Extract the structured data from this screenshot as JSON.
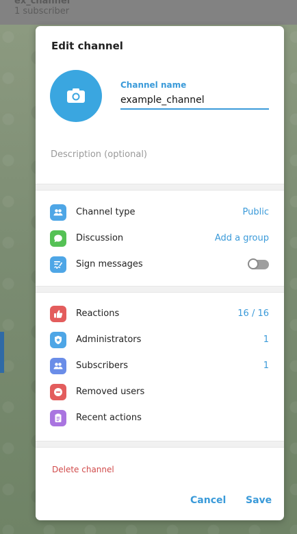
{
  "background": {
    "channel_title": "ex_channel",
    "channel_subtitle": "1 subscriber"
  },
  "modal": {
    "title": "Edit channel",
    "name_label": "Channel name",
    "name_value": "example_channel",
    "description_placeholder": "Description (optional)",
    "settings": [
      {
        "label": "Channel type",
        "value": "Public",
        "icon": "people-icon",
        "color": "#4ea6e6"
      },
      {
        "label": "Discussion",
        "value": "Add a group",
        "icon": "chat-bubble-icon",
        "color": "#55c155"
      },
      {
        "label": "Sign messages",
        "value": "",
        "icon": "signature-icon",
        "color": "#4ea6e6"
      }
    ],
    "sign_messages_enabled": false,
    "manage": [
      {
        "label": "Reactions",
        "value": "16 / 16",
        "icon": "thumbs-up-icon",
        "color": "#e35d5d"
      },
      {
        "label": "Administrators",
        "value": "1",
        "icon": "shield-star-icon",
        "color": "#4ea6e6"
      },
      {
        "label": "Subscribers",
        "value": "1",
        "icon": "people-icon",
        "color": "#6a8de8"
      },
      {
        "label": "Removed users",
        "value": "",
        "icon": "minus-circle-icon",
        "color": "#e35d5d"
      },
      {
        "label": "Recent actions",
        "value": "",
        "icon": "clipboard-icon",
        "color": "#a974e0"
      }
    ],
    "delete_label": "Delete channel",
    "cancel_label": "Cancel",
    "save_label": "Save"
  }
}
